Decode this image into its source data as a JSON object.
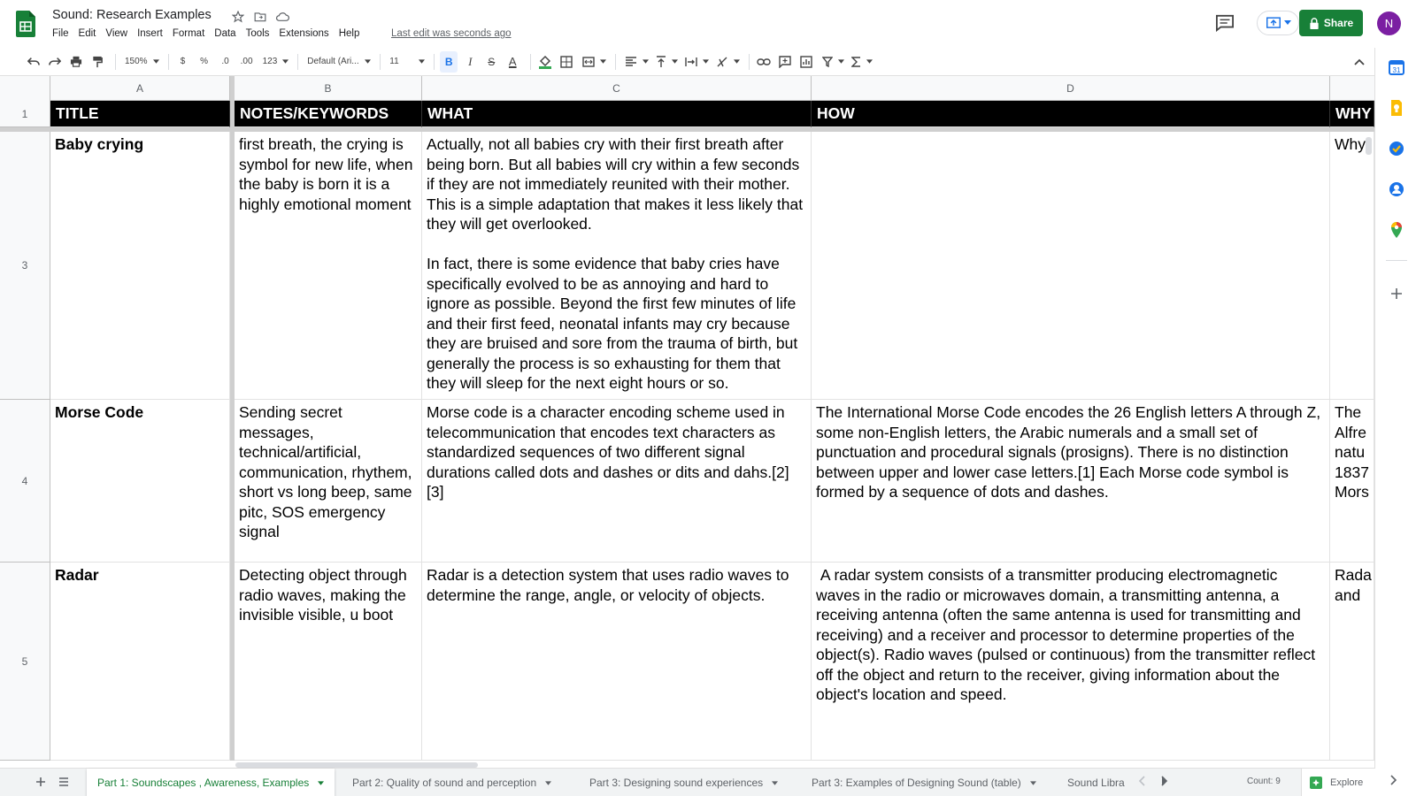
{
  "app": {
    "doc_title": "Sound: Research Examples",
    "menu": [
      "File",
      "Edit",
      "View",
      "Insert",
      "Format",
      "Data",
      "Tools",
      "Extensions",
      "Help"
    ],
    "last_edit": "Last edit was seconds ago",
    "share_label": "Share",
    "avatar_initial": "N",
    "accent_color": "#188038"
  },
  "toolbar": {
    "zoom": "150%",
    "currency": "$",
    "percent": "%",
    "dec_decrease": ".0",
    "dec_increase": ".00",
    "more_formats": "123",
    "font": "Default (Ari...",
    "font_size": "11",
    "bold": "B",
    "italic": "I",
    "strike": "S",
    "text_color": "A"
  },
  "grid": {
    "columns": [
      "A",
      "B",
      "C",
      "D"
    ],
    "row_numbers": [
      "1",
      "3",
      "4",
      "5"
    ],
    "header_row": [
      "TITLE",
      "NOTES/KEYWORDS",
      "WHAT",
      "HOW",
      "WHY"
    ],
    "rows": [
      {
        "title": "Baby crying",
        "notes": "first breath, the crying is symbol for new life, when the baby is born it is a highly emotional moment",
        "what": "Actually, not all babies cry with their first breath after being born. But all babies will cry within a few seconds if they are not immediately reunited with their mother. This is a simple adaptation that makes it less likely that they will get overlooked.\n\nIn fact, there is some evidence that baby cries have specifically evolved to be as annoying and hard to ignore as possible. Beyond the first few minutes of life and their first feed, neonatal infants may cry because they are bruised and sore from the trauma of birth, but generally the process is so exhausting for them that they will sleep for the next eight hours or so.",
        "how": "",
        "why": "Why"
      },
      {
        "title": "Morse Code",
        "notes": "Sending secret messages, technical/artificial, communication, rhythem, short vs long beep, same pitc, SOS emergency signal",
        "what": "Morse code is a character encoding scheme used in telecommunication that encodes text characters as standardized sequences of two different signal durations called dots and dashes or dits and dahs.[2][3]",
        "how": "The International Morse Code encodes the 26 English letters A through Z, some non-English letters, the Arabic numerals and a small set of punctuation and procedural signals (prosigns). There is no distinction between upper and lower case letters.[1] Each Morse code symbol is formed by a sequence of dots and dashes.",
        "why": "The Alfre natu 1837 Mors"
      },
      {
        "title": "Radar",
        "notes": "Detecting object through radio waves, making the invisible visible, u boot",
        "what": "Radar is a detection system that uses radio waves to determine the range, angle, or velocity of objects.",
        "how": " A radar system consists of a transmitter producing electromagnetic waves in the radio or microwaves domain, a transmitting antenna, a receiving antenna (often the same antenna is used for transmitting and receiving) and a receiver and processor to determine properties of the object(s). Radio waves (pulsed or continuous) from the transmitter reflect off the object and return to the receiver, giving information about the object's location and speed.",
        "why": "Rada and"
      }
    ]
  },
  "sheets": {
    "tabs": [
      "Part 1: Soundscapes , Awareness, Examples",
      "Part 2: Quality of sound and perception",
      "Part 3: Designing sound experiences",
      "Part 3: Examples of Designing Sound (table)",
      "Sound Libra"
    ],
    "count": "Count: 9",
    "explore": "Explore"
  }
}
